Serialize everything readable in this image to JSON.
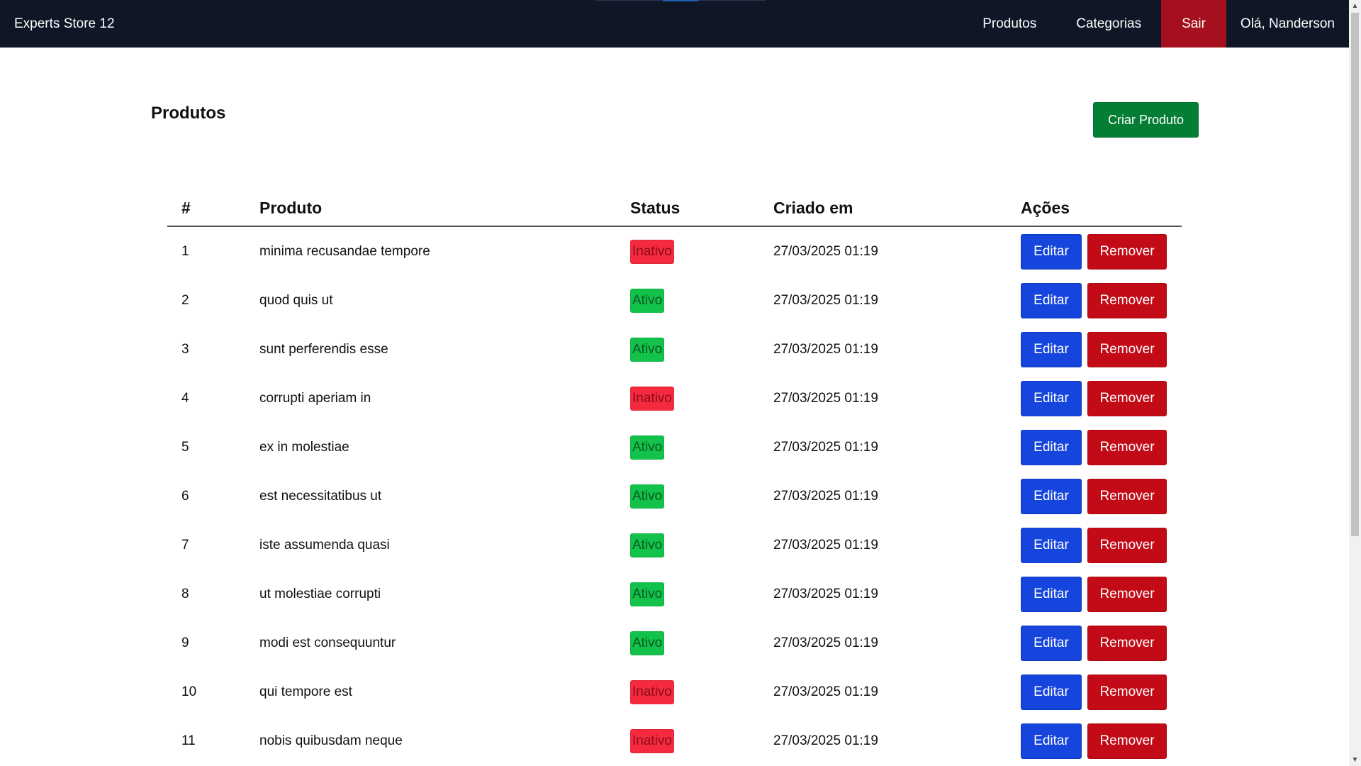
{
  "navbar": {
    "brand": "Experts Store 12",
    "items": [
      {
        "label": "Produtos"
      },
      {
        "label": "Categorias"
      }
    ],
    "logout_label": "Sair",
    "greeting": "Olá, Nanderson",
    "logout_color": "#a60f1e",
    "background_color": "#0f1626"
  },
  "page": {
    "title": "Produtos",
    "create_button": "Criar Produto"
  },
  "table": {
    "headers": {
      "num": "#",
      "product": "Produto",
      "status": "Status",
      "created": "Criado em",
      "actions": "Ações"
    },
    "edit_label": "Editar",
    "remove_label": "Remover",
    "rows": [
      {
        "id": "1",
        "name": "minima recusandae tempore",
        "status": "Inativo",
        "created": "27/03/2025 01:19"
      },
      {
        "id": "2",
        "name": "quod quis ut",
        "status": "Ativo",
        "created": "27/03/2025 01:19"
      },
      {
        "id": "3",
        "name": "sunt perferendis esse",
        "status": "Ativo",
        "created": "27/03/2025 01:19"
      },
      {
        "id": "4",
        "name": "corrupti aperiam in",
        "status": "Inativo",
        "created": "27/03/2025 01:19"
      },
      {
        "id": "5",
        "name": "ex in molestiae",
        "status": "Ativo",
        "created": "27/03/2025 01:19"
      },
      {
        "id": "6",
        "name": "est necessitatibus ut",
        "status": "Ativo",
        "created": "27/03/2025 01:19"
      },
      {
        "id": "7",
        "name": "iste assumenda quasi",
        "status": "Ativo",
        "created": "27/03/2025 01:19"
      },
      {
        "id": "8",
        "name": "ut molestiae corrupti",
        "status": "Ativo",
        "created": "27/03/2025 01:19"
      },
      {
        "id": "9",
        "name": "modi est consequuntur",
        "status": "Ativo",
        "created": "27/03/2025 01:19"
      },
      {
        "id": "10",
        "name": "qui tempore est",
        "status": "Inativo",
        "created": "27/03/2025 01:19"
      },
      {
        "id": "11",
        "name": "nobis quibusdam neque",
        "status": "Inativo",
        "created": "27/03/2025 01:19"
      }
    ]
  },
  "colors": {
    "create_button": "#057e35",
    "edit_button": "#1545dc",
    "remove_button": "#c30a17",
    "badge_active": "#12c24a",
    "badge_inactive": "#f52a3e"
  },
  "icons": {
    "scroll_up": "scroll-up-arrow-icon",
    "scroll_down": "scroll-down-arrow-icon"
  }
}
